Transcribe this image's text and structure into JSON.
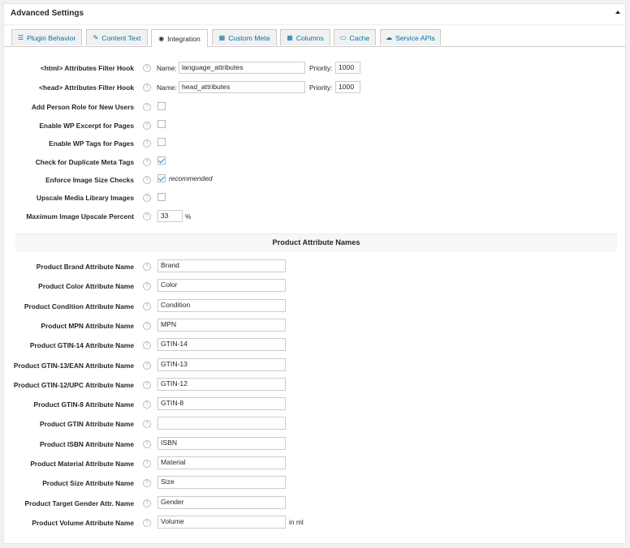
{
  "panel": {
    "title": "Advanced Settings"
  },
  "tabs": [
    {
      "label": "Plugin Behavior",
      "icon": "sliders-icon"
    },
    {
      "label": "Content Text",
      "icon": "edit-icon"
    },
    {
      "label": "Integration",
      "icon": "visibility-icon"
    },
    {
      "label": "Custom Meta",
      "icon": "table-icon"
    },
    {
      "label": "Columns",
      "icon": "columns-icon"
    },
    {
      "label": "Cache",
      "icon": "folder-icon"
    },
    {
      "label": "Service APIs",
      "icon": "cloud-icon"
    }
  ],
  "settings": {
    "html_hook": {
      "label": "<html> Attributes Filter Hook",
      "name_label": "Name:",
      "name_value": "language_attributes",
      "priority_label": "Priority:",
      "priority_value": "1000"
    },
    "head_hook": {
      "label": "<head> Attributes Filter Hook",
      "name_label": "Name:",
      "name_value": "head_attributes",
      "priority_label": "Priority:",
      "priority_value": "1000"
    },
    "person_role": {
      "label": "Add Person Role for New Users",
      "checked": false
    },
    "wp_excerpt": {
      "label": "Enable WP Excerpt for Pages",
      "checked": false
    },
    "wp_tags": {
      "label": "Enable WP Tags for Pages",
      "checked": false
    },
    "duplicate_meta": {
      "label": "Check for Duplicate Meta Tags",
      "checked": true
    },
    "image_size": {
      "label": "Enforce Image Size Checks",
      "checked": true,
      "note": "recommended"
    },
    "upscale_media": {
      "label": "Upscale Media Library Images",
      "checked": false
    },
    "upscale_percent": {
      "label": "Maximum Image Upscale Percent",
      "value": "33",
      "unit": "%"
    }
  },
  "attributes_section": {
    "title": "Product Attribute Names"
  },
  "attributes": [
    {
      "label": "Product Brand Attribute Name",
      "value": "Brand"
    },
    {
      "label": "Product Color Attribute Name",
      "value": "Color"
    },
    {
      "label": "Product Condition Attribute Name",
      "value": "Condition"
    },
    {
      "label": "Product MPN Attribute Name",
      "value": "MPN"
    },
    {
      "label": "Product GTIN-14 Attribute Name",
      "value": "GTIN-14"
    },
    {
      "label": "Product GTIN-13/EAN Attribute Name",
      "value": "GTIN-13"
    },
    {
      "label": "Product GTIN-12/UPC Attribute Name",
      "value": "GTIN-12"
    },
    {
      "label": "Product GTIN-8 Attribute Name",
      "value": "GTIN-8"
    },
    {
      "label": "Product GTIN Attribute Name",
      "value": ""
    },
    {
      "label": "Product ISBN Attribute Name",
      "value": "ISBN"
    },
    {
      "label": "Product Material Attribute Name",
      "value": "Material"
    },
    {
      "label": "Product Size Attribute Name",
      "value": "Size"
    },
    {
      "label": "Product Target Gender Attr. Name",
      "value": "Gender"
    },
    {
      "label": "Product Volume Attribute Name",
      "value": "Volume",
      "suffix": "in ml"
    }
  ]
}
